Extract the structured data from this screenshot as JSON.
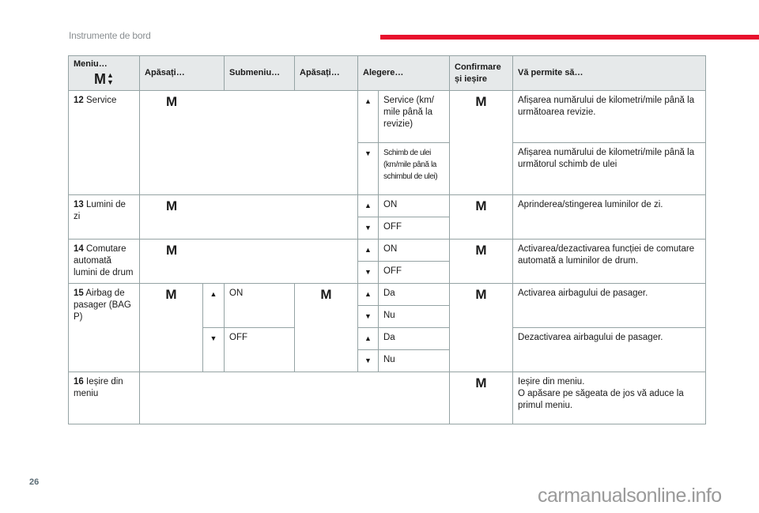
{
  "page": {
    "section_title": "Instrumente de bord",
    "page_number": "26",
    "watermark": "carmanualsonline.info",
    "accent_color": "#e8112d"
  },
  "icons": {
    "m_button": "M",
    "up": "▲",
    "down": "▼"
  },
  "header": {
    "menu": "Meniu…",
    "press1": "Apăsați…",
    "submenu": "Submeniu…",
    "press2": "Apăsați…",
    "choice": "Alegere…",
    "confirm": "Confirmare și ieșire",
    "allows": "Vă permite să…"
  },
  "rows": {
    "r12": {
      "num": "12",
      "label": "Service",
      "choices": [
        {
          "text": "Service (km/ mile până la revizie)",
          "desc": "Afișarea numărului de kilometri/mile până la următoarea revizie."
        },
        {
          "text": "Schimb de ulei (km/mile până la schimbul de ulei)",
          "desc": "Afișarea numărului de kilometri/mile până la următorul schimb de ulei"
        }
      ]
    },
    "r13": {
      "num": "13",
      "label": "Lumini de zi",
      "choices": [
        {
          "text": "ON"
        },
        {
          "text": "OFF"
        }
      ],
      "desc": "Aprinderea/stingerea luminilor de zi."
    },
    "r14": {
      "num": "14",
      "label": "Comutare automată lumini de drum",
      "choices": [
        {
          "text": "ON"
        },
        {
          "text": "OFF"
        }
      ],
      "desc": "Activarea/dezactivarea funcției de comutare automată a luminilor de drum."
    },
    "r15": {
      "num": "15",
      "label": "Airbag de pasager (BAG P)",
      "submenu": [
        {
          "text": "ON"
        },
        {
          "text": "OFF"
        }
      ],
      "choices": [
        {
          "text": "Da"
        },
        {
          "text": "Nu"
        },
        {
          "text": "Da"
        },
        {
          "text": "Nu"
        }
      ],
      "desc_on": "Activarea airbagului de pasager.",
      "desc_off": "Dezactivarea airbagului de pasager."
    },
    "r16": {
      "num": "16",
      "label": "Ieșire din meniu",
      "desc_line1": "Ieșire din meniu.",
      "desc_line2": "O apăsare pe săgeata de jos vă aduce la primul meniu."
    }
  }
}
